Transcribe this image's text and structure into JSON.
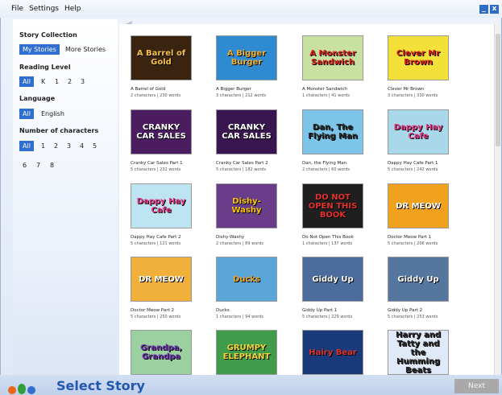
{
  "menu": {
    "file": "File",
    "settings": "Settings",
    "help": "Help"
  },
  "window_buttons": {
    "minimize": "_",
    "close": "x"
  },
  "sidebar": {
    "story_collection": {
      "title": "Story Collection",
      "options": [
        "My Stories",
        "More Stories"
      ],
      "selected": "My Stories"
    },
    "reading_level": {
      "title": "Reading Level",
      "options": [
        "All",
        "K",
        "1",
        "2",
        "3"
      ],
      "selected": "All"
    },
    "language": {
      "title": "Language",
      "options": [
        "All",
        "English"
      ],
      "selected": "All"
    },
    "characters": {
      "title": "Number of characters",
      "options": [
        "All",
        "1",
        "2",
        "3",
        "4",
        "5",
        "6",
        "7",
        "8"
      ],
      "selected": "All"
    }
  },
  "stories": [
    {
      "name": "A Barrel of Gold",
      "meta": "2 characters | 230 words",
      "thumb_text": "A Barrel of Gold",
      "bg": "#3a2410",
      "fg": "#f4c24a"
    },
    {
      "name": "A Bigger Burger",
      "meta": "3 characters | 212 words",
      "thumb_text": "A Bigger Burger",
      "bg": "#2e8bd2",
      "fg": "#f2b233"
    },
    {
      "name": "A Monster Sandwich",
      "meta": "1 characters | 41 words",
      "thumb_text": "A Monster Sandwich",
      "bg": "#c8e1a0",
      "fg": "#d9251c"
    },
    {
      "name": "Clever Mr Brown",
      "meta": "3 characters | 330 words",
      "thumb_text": "Clever Mr Brown",
      "bg": "#f3e13a",
      "fg": "#d9251c"
    },
    {
      "name": "Cranky Car Sales Part 1",
      "meta": "5 characters | 232 words",
      "thumb_text": "CRANKY CAR SALES",
      "bg": "#4b1c5f",
      "fg": "#ffffff"
    },
    {
      "name": "Cranky Car Sales Part 2",
      "meta": "5 characters | 182 words",
      "thumb_text": "CRANKY CAR SALES",
      "bg": "#3a1650",
      "fg": "#ffffff"
    },
    {
      "name": "Dan, the Flying Man",
      "meta": "2 characters | 60 words",
      "thumb_text": "Dan, The Flying Man",
      "bg": "#7cc4e8",
      "fg": "#2a2a2a"
    },
    {
      "name": "Dappy Hay Cafe Part 1",
      "meta": "5 characters | 242 words",
      "thumb_text": "Dappy Hay Cafe",
      "bg": "#a8d8ea",
      "fg": "#e53b8a"
    },
    {
      "name": "Dappy Hay Cafe Part 2",
      "meta": "5 characters | 121 words",
      "thumb_text": "Dappy Hay Cafe",
      "bg": "#bfe4f1",
      "fg": "#e53b8a"
    },
    {
      "name": "Dishy-Washy",
      "meta": "2 characters | 89 words",
      "thumb_text": "Dishy-Washy",
      "bg": "#6a3d8a",
      "fg": "#f9c600"
    },
    {
      "name": "Do Not Open This Book",
      "meta": "1 characters | 137 words",
      "thumb_text": "DO NOT OPEN THIS BOOK",
      "bg": "#1f1f1f",
      "fg": "#e5312a"
    },
    {
      "name": "Doctor Meow Part 1",
      "meta": "5 characters | 206 words",
      "thumb_text": "DR MEOW",
      "bg": "#f0a21f",
      "fg": "#ffffff"
    },
    {
      "name": "Doctor Meow Part 2",
      "meta": "5 characters | 250 words",
      "thumb_text": "DR MEOW",
      "bg": "#f0b03a",
      "fg": "#ffffff"
    },
    {
      "name": "Ducks",
      "meta": "1 characters | 94 words",
      "thumb_text": "Ducks",
      "bg": "#5aa6d8",
      "fg": "#f0a21f"
    },
    {
      "name": "Giddy Up Part 1",
      "meta": "5 characters | 229 words",
      "thumb_text": "Giddy Up",
      "bg": "#4b6c9c",
      "fg": "#ffffff"
    },
    {
      "name": "Giddy Up Part 2",
      "meta": "5 characters | 253 words",
      "thumb_text": "Giddy Up",
      "bg": "#55779f",
      "fg": "#ffffff"
    },
    {
      "name": "",
      "meta": "",
      "thumb_text": "Grandpa, Grandpa",
      "bg": "#9bd0a0",
      "fg": "#6d2fb0"
    },
    {
      "name": "",
      "meta": "",
      "thumb_text": "GRUMPY ELEPHANT",
      "bg": "#3f9c4b",
      "fg": "#f7d43a"
    },
    {
      "name": "",
      "meta": "",
      "thumb_text": "Hairy Bear",
      "bg": "#183a7a",
      "fg": "#e5312a"
    },
    {
      "name": "",
      "meta": "",
      "thumb_text": "Harry and Tatty and the Humming Beats",
      "bg": "#dfe9f7",
      "fg": "#2a2a2a"
    }
  ],
  "footer": {
    "title": "Select Story",
    "next": "Next"
  },
  "colors": {
    "selected": "#2f6fd0",
    "title": "#2357b1",
    "next_disabled": "#a9a9a9"
  }
}
